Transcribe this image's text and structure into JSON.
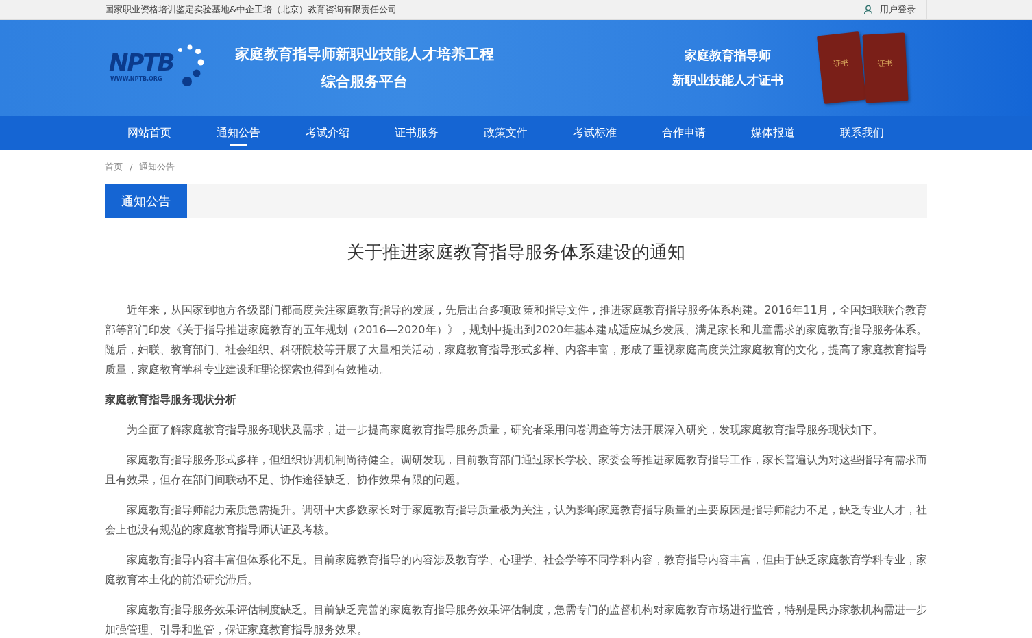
{
  "top_bar": {
    "company": "国家职业资格培训鉴定实验基地&中企工培（北京）教育咨询有限责任公司",
    "login": "用户登录"
  },
  "banner": {
    "logo_text": "NPTB",
    "logo_url": "WWW.NPTB.ORG",
    "title_lines": [
      "家庭教育指导师新职业技能人才培养工程",
      "综合服务平台"
    ],
    "cert_lines": [
      "家庭教育指导师",
      "新职业技能人才证书"
    ],
    "book_labels": [
      "证书",
      "证书"
    ]
  },
  "nav": [
    {
      "label": "网站首页",
      "selected": false
    },
    {
      "label": "通知公告",
      "selected": true
    },
    {
      "label": "考试介绍",
      "selected": false
    },
    {
      "label": "证书服务",
      "selected": false
    },
    {
      "label": "政策文件",
      "selected": false
    },
    {
      "label": "考试标准",
      "selected": false
    },
    {
      "label": "合作申请",
      "selected": false
    },
    {
      "label": "媒体报道",
      "selected": false
    },
    {
      "label": "联系我们",
      "selected": false
    }
  ],
  "breadcrumb": {
    "items": [
      "首页",
      "通知公告"
    ],
    "separator": "/"
  },
  "section_tab": "通知公告",
  "article": {
    "title": "关于推进家庭教育指导服务体系建设的通知",
    "body": [
      {
        "kind": "paragraph",
        "text": "近年来，从国家到地方各级部门都高度关注家庭教育指导的发展，先后出台多项政策和指导文件，推进家庭教育指导服务体系构建。2016年11月，全国妇联联合教育部等部门印发《关于指导推进家庭教育的五年规划（2016—2020年）》，规划中提出到2020年基本建成适应城乡发展、满足家长和儿童需求的家庭教育指导服务体系。随后，妇联、教育部门、社会组织、科研院校等开展了大量相关活动，家庭教育指导形式多样、内容丰富，形成了重视家庭高度关注家庭教育的文化，提高了家庭教育指导质量，家庭教育学科专业建设和理论探索也得到有效推动。"
      },
      {
        "kind": "heading",
        "text": "家庭教育指导服务现状分析"
      },
      {
        "kind": "paragraph",
        "text": "为全面了解家庭教育指导服务现状及需求，进一步提高家庭教育指导服务质量，研究者采用问卷调查等方法开展深入研究，发现家庭教育指导服务现状如下。"
      },
      {
        "kind": "paragraph",
        "text": "家庭教育指导服务形式多样，但组织协调机制尚待健全。调研发现，目前教育部门通过家长学校、家委会等推进家庭教育指导工作，家长普遍认为对这些指导有需求而且有效果，但存在部门间联动不足、协作途径缺乏、协作效果有限的问题。"
      },
      {
        "kind": "paragraph",
        "text": "家庭教育指导师能力素质急需提升。调研中大多数家长对于家庭教育指导质量极为关注，认为影响家庭教育指导质量的主要原因是指导师能力不足，缺乏专业人才，社会上也没有规范的家庭教育指导师认证及考核。"
      },
      {
        "kind": "paragraph",
        "text": "家庭教育指导内容丰富但体系化不足。目前家庭教育指导的内容涉及教育学、心理学、社会学等不同学科内容，教育指导内容丰富，但由于缺乏家庭教育学科专业，家庭教育本土化的前沿研究滞后。"
      },
      {
        "kind": "paragraph",
        "text": "家庭教育指导服务效果评估制度缺乏。目前缺乏完善的家庭教育指导服务效果评估制度，急需专门的监督机构对家庭教育市场进行监管，特别是民办家教机构需进一步加强管理、引导和监管，保证家庭教育指导服务效果。"
      }
    ]
  }
}
